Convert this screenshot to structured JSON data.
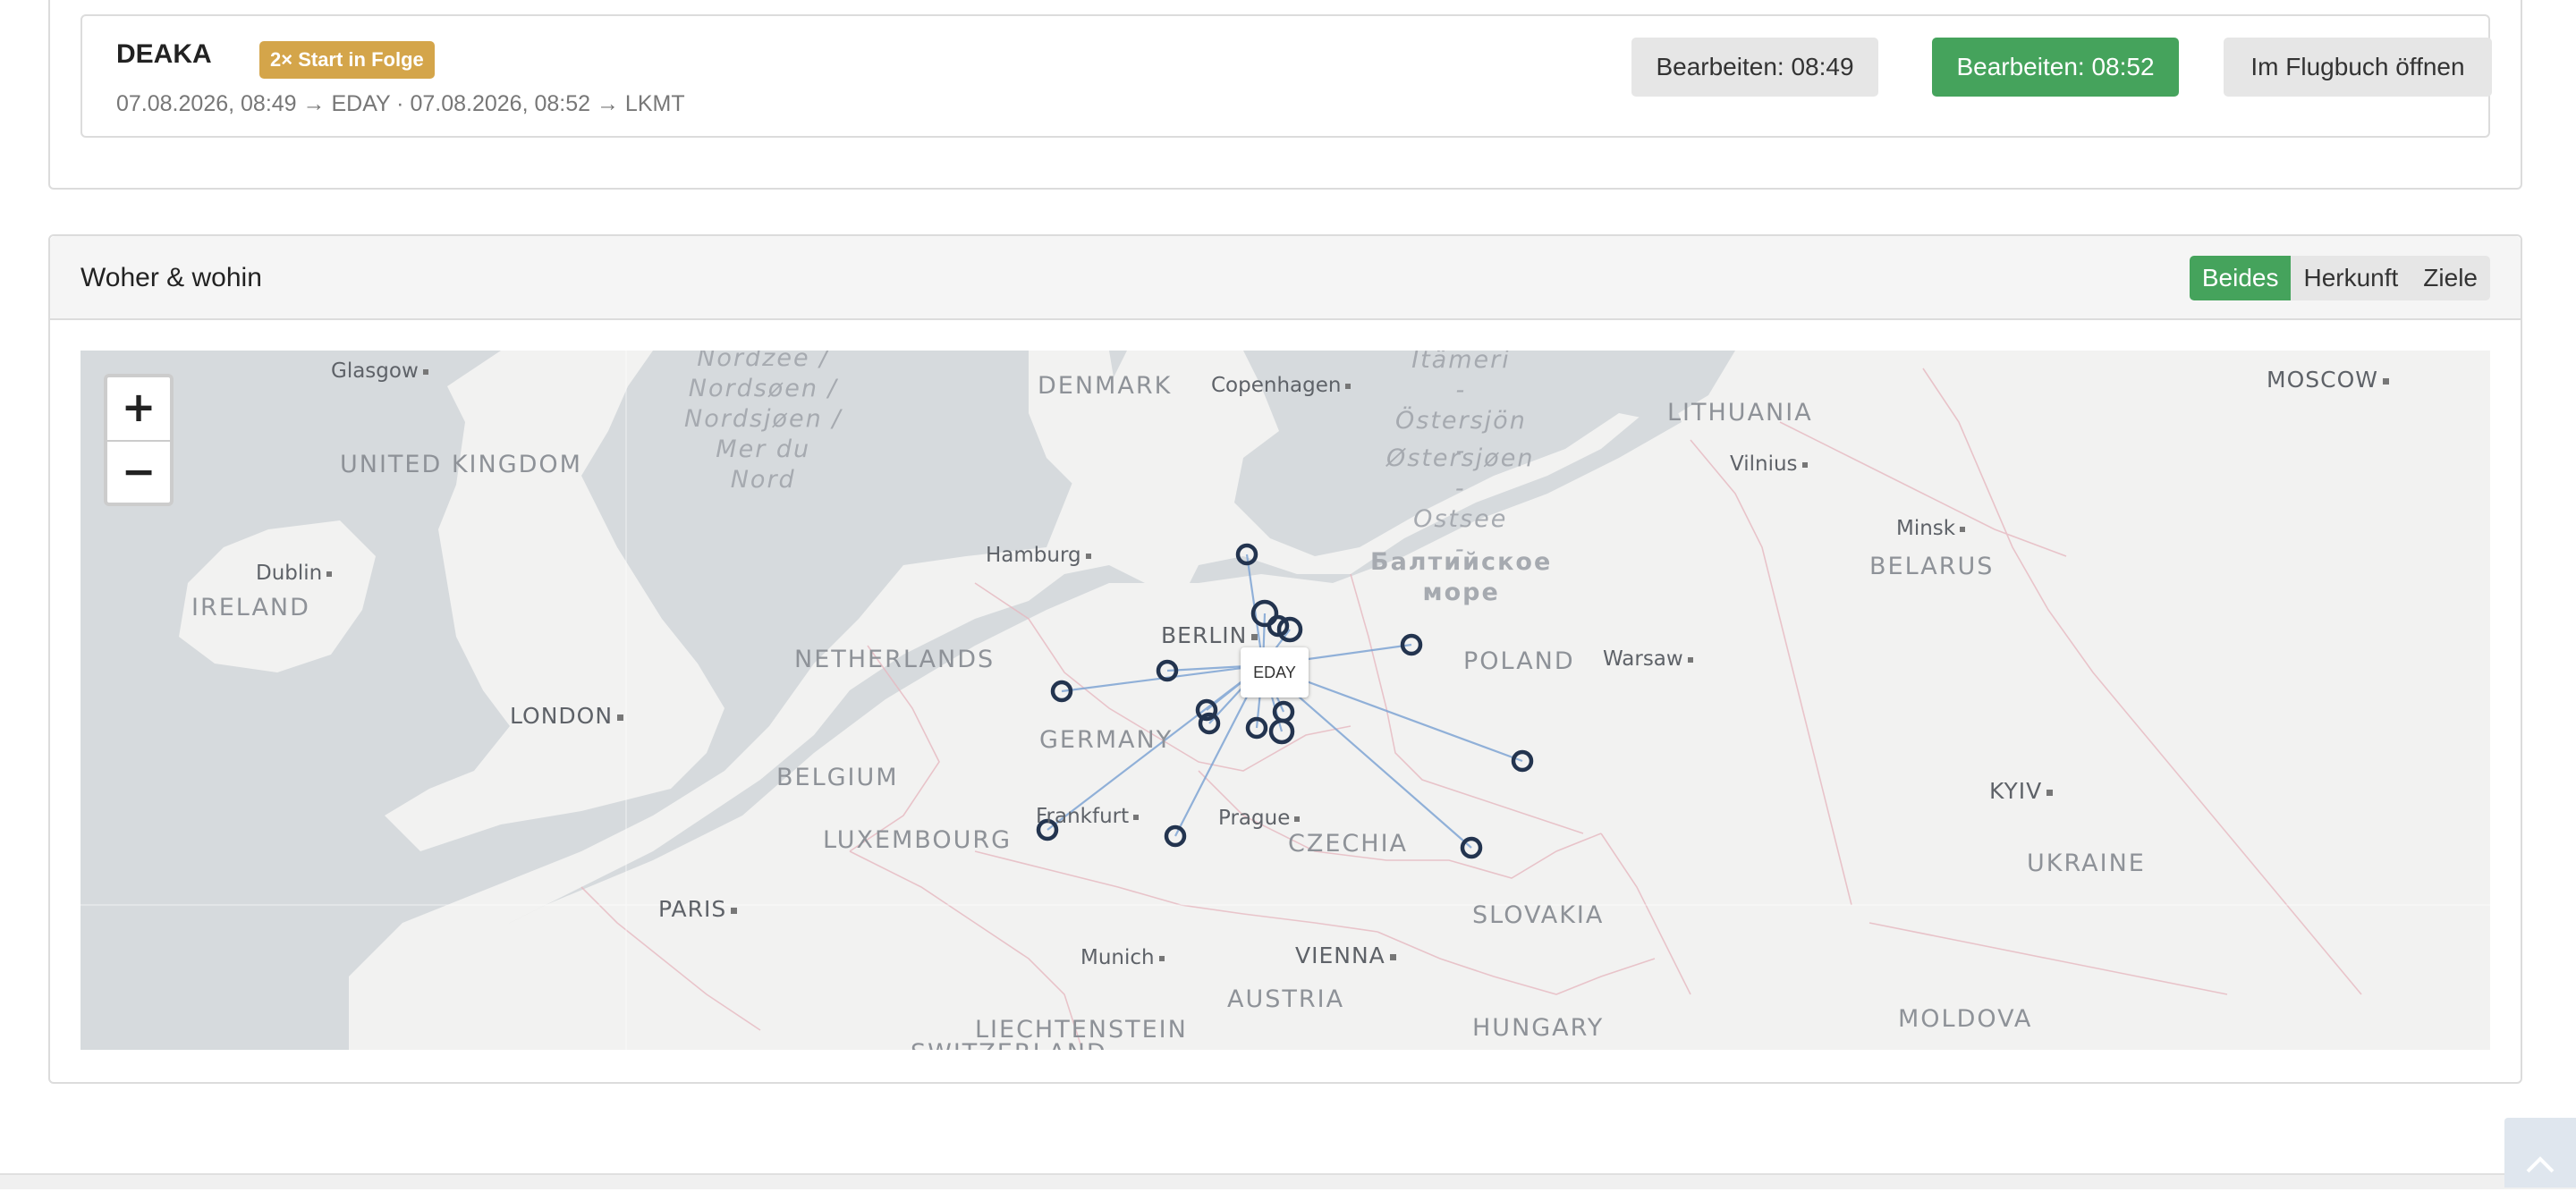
{
  "warning": {
    "title": "DEAKA",
    "badge": "2× Start in Folge",
    "detail": "07.08.2026, 08:49 → EDAY  ·  07.08.2026, 08:52 → LKMT",
    "buttons": {
      "edit_first": "Bearbeiten: 08:49",
      "edit_second": "Bearbeiten: 08:52",
      "open_logbook": "Im Flugbuch öffnen"
    }
  },
  "map_panel": {
    "title": "Woher & wohin",
    "filter": {
      "options": [
        "Beides",
        "Herkunft",
        "Ziele"
      ],
      "selected": "Beides"
    },
    "zoom": {
      "in": "+",
      "out": "−"
    },
    "home_airfield": "EDAY",
    "labels": {
      "countries": [
        "UNITED KINGDOM",
        "IRELAND",
        "DENMARK",
        "LITHUANIA",
        "BELARUS",
        "NETHERLANDS",
        "POLAND",
        "GERMANY",
        "BELGIUM",
        "LUXEMBOURG",
        "CZECHIA",
        "SLOVAKIA",
        "UKRAINE",
        "AUSTRIA",
        "HUNGARY",
        "MOLDOVA",
        "LIECHTENSTEIN",
        "SWITZERLAND"
      ],
      "cities": [
        "Glasgow",
        "Copenhagen",
        "MOSCOW",
        "Vilnius",
        "Minsk",
        "Dublin",
        "Hamburg",
        "BERLIN",
        "LONDON",
        "Warsaw",
        "KYIV",
        "Frankfurt",
        "Prague",
        "PARIS",
        "Munich",
        "VIENNA"
      ],
      "seas": {
        "north": "Nordzee /\nNordsøen /\nNordsjøen /\nMer du\nNord",
        "baltic_fi": "Itämeri\n-\nÖstersjön\n-",
        "baltic_pl": "Østersjøen\n-\nOstsee\n-",
        "baltic_ru": "Балтийское\nморе"
      }
    }
  }
}
